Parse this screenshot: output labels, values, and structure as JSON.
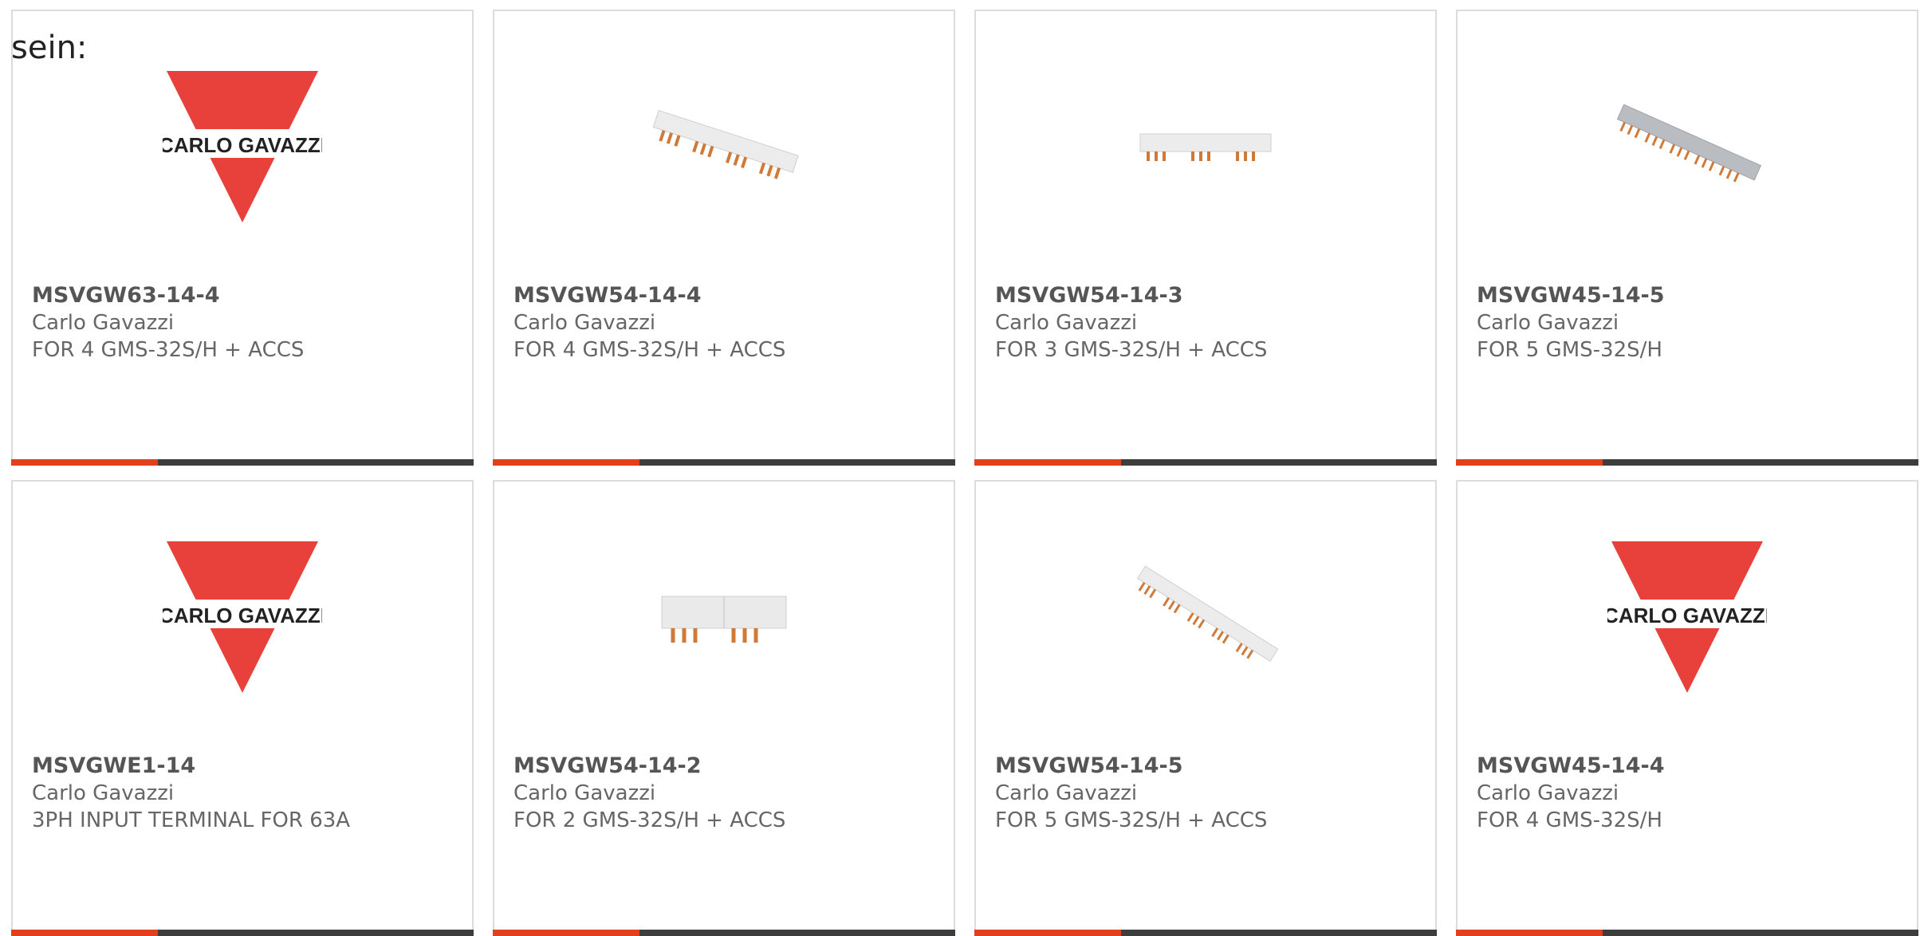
{
  "intro_text": "sein:",
  "colors": {
    "accent": "#e2401c",
    "bar": "#3d3d3d",
    "logo_red": "#e8403a",
    "card_border": "#dcdcdc"
  },
  "products": [
    {
      "name": "MSVGW63-14-4",
      "brand": "Carlo Gavazzi",
      "description": "FOR 4 GMS-32S/H + ACCS",
      "image": "carlo-gavazzi-logo",
      "logo_text": "CARLO GAVAZZI"
    },
    {
      "name": "MSVGW54-14-4",
      "brand": "Carlo Gavazzi",
      "description": "FOR 4 GMS-32S/H + ACCS",
      "image": "busbar-4-diagonal"
    },
    {
      "name": "MSVGW54-14-3",
      "brand": "Carlo Gavazzi",
      "description": "FOR 3 GMS-32S/H + ACCS",
      "image": "busbar-3-flat"
    },
    {
      "name": "MSVGW45-14-5",
      "brand": "Carlo Gavazzi",
      "description": "FOR 5 GMS-32S/H",
      "image": "busbar-5-grey"
    },
    {
      "name": "MSVGWE1-14",
      "brand": "Carlo Gavazzi",
      "description": "3PH INPUT TERMINAL FOR 63A",
      "image": "carlo-gavazzi-logo",
      "logo_text": "CARLO GAVAZZI"
    },
    {
      "name": "MSVGW54-14-2",
      "brand": "Carlo Gavazzi",
      "description": "FOR 2 GMS-32S/H + ACCS",
      "image": "busbar-2-block"
    },
    {
      "name": "MSVGW54-14-5",
      "brand": "Carlo Gavazzi",
      "description": "FOR 5 GMS-32S/H + ACCS",
      "image": "busbar-5-diagonal"
    },
    {
      "name": "MSVGW45-14-4",
      "brand": "Carlo Gavazzi",
      "description": "FOR 4 GMS-32S/H",
      "image": "carlo-gavazzi-logo",
      "logo_text": "CARLO GAVAZZI"
    }
  ]
}
